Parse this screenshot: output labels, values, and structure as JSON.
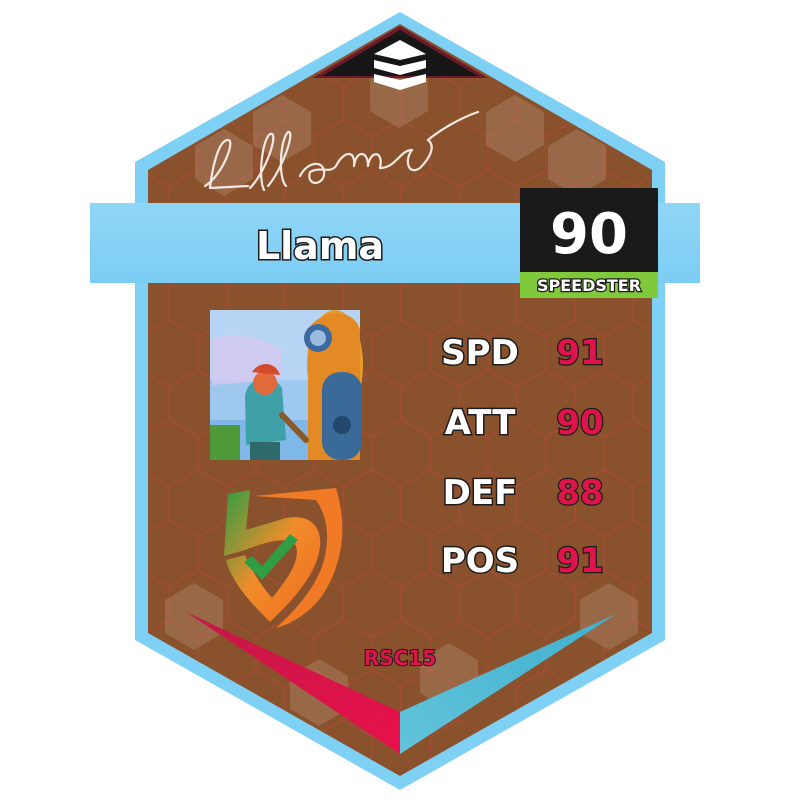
{
  "player": {
    "name": "Llama",
    "rating": "90",
    "role": "SPEEDSTER",
    "team_tag": "RSC15"
  },
  "stats": [
    {
      "label": "SPD",
      "value": "91"
    },
    {
      "label": "ATT",
      "value": "90"
    },
    {
      "label": "DEF",
      "value": "88"
    },
    {
      "label": "POS",
      "value": "91"
    }
  ],
  "icons": {
    "top_emblem": "stacked-chevrons-icon",
    "team_logo": "shield-logo-icon",
    "signature": "signature-graphic"
  },
  "colors": {
    "card_background": "#8a522c",
    "border": "#7fd0f5",
    "name_band": "#8dd5f7",
    "rating_box": "#1a1a1a",
    "role_badge": "#80c93a",
    "stat_value": "#e0144c",
    "accent_red": "#e0144c",
    "accent_cyan": "#5fc0d8"
  }
}
